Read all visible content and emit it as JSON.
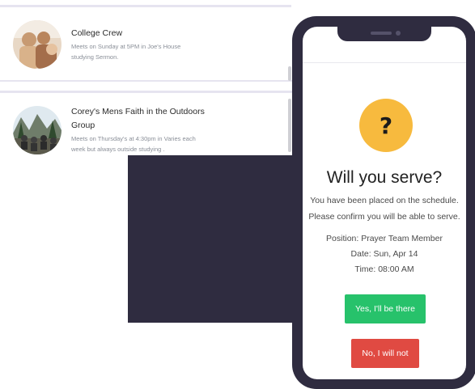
{
  "groups": [
    {
      "title": "College Crew",
      "description_line1": "Meets on Sunday at 5PM in Joe's House",
      "description_line2": "studying Sermon."
    },
    {
      "title_line1": "Corey's Mens Faith in the Outdoors",
      "title_line2": "Group",
      "description_line1": "Meets on Thursday's at 4:30pm in Varies each",
      "description_line2": "week but always outside studying ."
    }
  ],
  "modal": {
    "icon": "question-icon",
    "icon_glyph": "?",
    "title": "Will you serve?",
    "message_line1": "You have been placed on the schedule.",
    "message_line2": "Please confirm you will be able to serve.",
    "position": "Position: Prayer Team Member",
    "date": "Date: Sun, Apr 14",
    "time": "Time: 08:00 AM",
    "confirm_label": "Yes, I'll be there",
    "decline_label": "No, I will not"
  },
  "colors": {
    "phone_frame": "#2f2c40",
    "icon_bg": "#f7ba3e",
    "confirm_bg": "#27c26b",
    "decline_bg": "#e04a42"
  }
}
